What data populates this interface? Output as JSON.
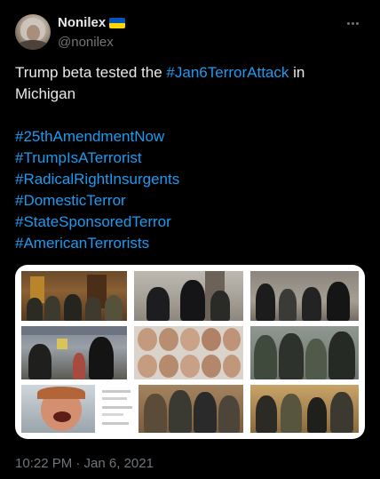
{
  "author": {
    "display_name": "Nonilex",
    "handle": "@nonilex",
    "flag_icon": "ukraine-flag-icon",
    "avatar_icon": "profile-avatar"
  },
  "menu_icon": "more-options-icon",
  "tweet": {
    "text_part1": "Trump beta tested the ",
    "hashtag_inline": "#Jan6TerrorAttack",
    "text_part2": " in",
    "text_line2": "Michigan",
    "hashtags": [
      "#25thAmendmentNow",
      "#TrumpIsATerrorist",
      "#RadicalRightInsurgents",
      "#DomesticTerror",
      "#StateSponsoredTerror",
      "#AmericanTerrorists"
    ],
    "timestamp": "10:22 PM · Jan 6, 2021"
  },
  "colors": {
    "background": "#000000",
    "text": "#e7e9ea",
    "secondary": "#71767b",
    "link": "#1d9bf0"
  },
  "media": {
    "description_icon": "photo-collage"
  }
}
